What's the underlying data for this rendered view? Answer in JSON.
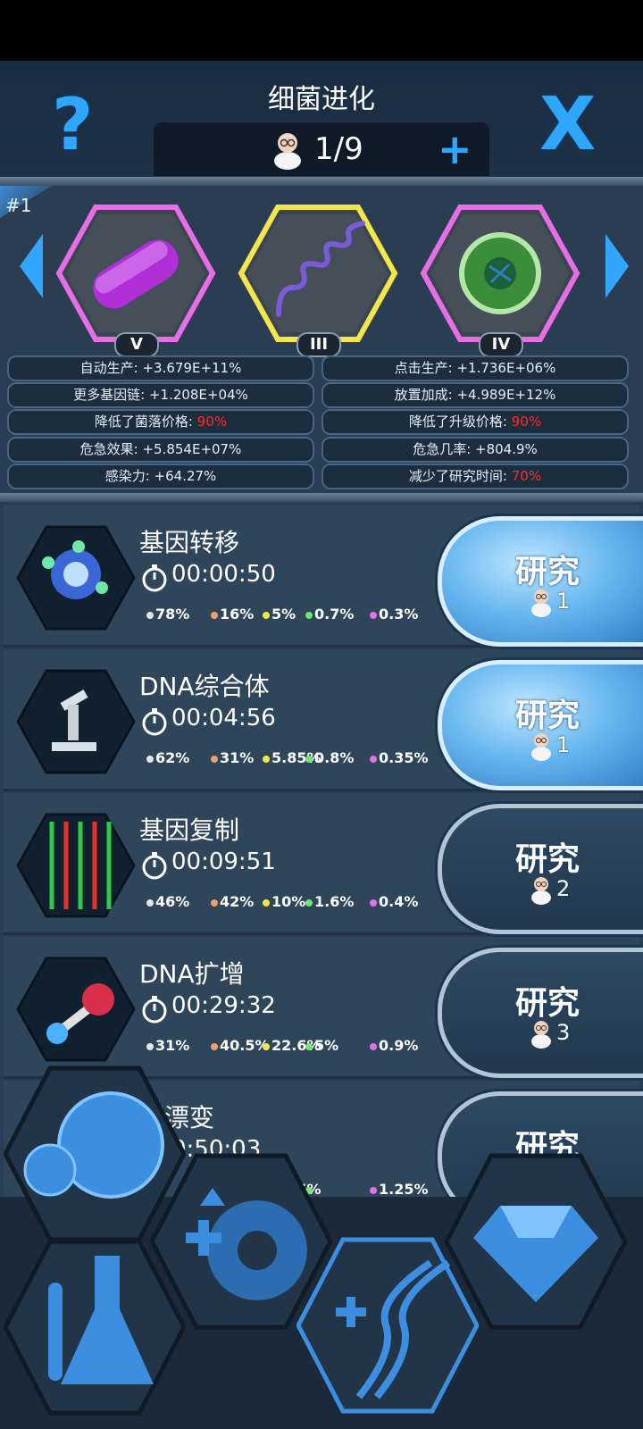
{
  "header": {
    "title": "细菌进化",
    "help_icon": "?",
    "close_icon": "X",
    "scientists": "1/9",
    "add_label": "+"
  },
  "strains": {
    "rank": "#1",
    "slots": [
      {
        "icon": "bacillus-icon",
        "level": "V",
        "frame_color": "#e86ee8"
      },
      {
        "icon": "spirillum-icon",
        "level": "III",
        "frame_color": "#f2e64a"
      },
      {
        "icon": "coccus-icon",
        "level": "IV",
        "frame_color": "#e86ee8"
      }
    ]
  },
  "stats": {
    "left": [
      {
        "label": "自动生产: +3.679E+11%",
        "highlight": ""
      },
      {
        "label": "更多基因链: +1.208E+04%",
        "highlight": ""
      },
      {
        "label": "降低了菌落价格: ",
        "highlight": "90%"
      },
      {
        "label": "危急效果: +5.854E+07%",
        "highlight": ""
      },
      {
        "label": "感染力: +64.27%",
        "highlight": ""
      }
    ],
    "right": [
      {
        "label": "点击生产: +1.736E+06%",
        "highlight": ""
      },
      {
        "label": "放置加成: +4.989E+12%",
        "highlight": ""
      },
      {
        "label": "降低了升级价格: ",
        "highlight": "90%"
      },
      {
        "label": "危急几率: +804.9%",
        "highlight": ""
      },
      {
        "label": "减少了研究时间: ",
        "highlight": "70%"
      }
    ]
  },
  "research_items": [
    {
      "name": "基因转移",
      "time": "00:00:50",
      "icon": "gene-transfer-icon",
      "pcts": [
        "78%",
        "16%",
        "5%",
        "0.7%",
        "0.3%"
      ],
      "button": "研究",
      "cost": "1",
      "active": true
    },
    {
      "name": "DNA综合体",
      "time": "00:04:56",
      "icon": "microscope-icon",
      "pcts": [
        "62%",
        "31%",
        "5.85%",
        "0.8%",
        "0.35%"
      ],
      "button": "研究",
      "cost": "1",
      "active": true
    },
    {
      "name": "基因复制",
      "time": "00:09:51",
      "icon": "dna-strands-icon",
      "pcts": [
        "46%",
        "42%",
        "10%",
        "1.6%",
        "0.4%"
      ],
      "button": "研究",
      "cost": "2",
      "active": false
    },
    {
      "name": "DNA扩增",
      "time": "00:29:32",
      "icon": "molecule-icon",
      "pcts": [
        "31%",
        "40.5%",
        "22.6%",
        "5%",
        "0.9%"
      ],
      "button": "研究",
      "cost": "3",
      "active": false
    },
    {
      "name": "因漂变",
      "time": "0:50:03",
      "icon": "drift-icon",
      "pcts": [
        "",
        "",
        "9.25%",
        "",
        "1.25%"
      ],
      "button": "研究",
      "cost": "",
      "active": false
    }
  ],
  "pct_colors": [
    "#e6e6e6",
    "#f0a070",
    "#f2e64a",
    "#6ee86e",
    "#e86ee8"
  ],
  "bottom_nav": [
    {
      "name": "colony-nav-icon"
    },
    {
      "name": "upgrades-nav-icon"
    },
    {
      "name": "lab-nav-icon"
    },
    {
      "name": "evolution-nav-icon"
    },
    {
      "name": "gems-nav-icon"
    }
  ]
}
